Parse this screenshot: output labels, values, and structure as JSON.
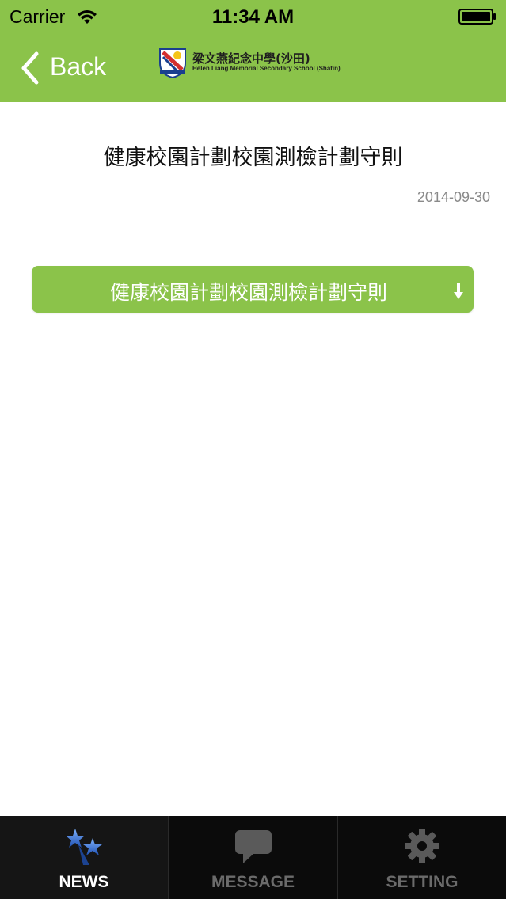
{
  "status_bar": {
    "carrier": "Carrier",
    "time": "11:34 AM"
  },
  "nav": {
    "back_label": "Back",
    "school_name_zh": "梁文燕紀念中學(沙田)",
    "school_name_en": "Helen Liang Memorial Secondary School (Shatin)"
  },
  "article": {
    "title": "健康校園計劃校園測檢計劃守則",
    "date": "2014-09-30",
    "attachment_label": "健康校園計劃校園測檢計劃守則"
  },
  "tabs": [
    {
      "label": "NEWS",
      "icon": "stars-icon",
      "selected": true
    },
    {
      "label": "MESSAGE",
      "icon": "speech-bubble-icon",
      "selected": false
    },
    {
      "label": "SETTING",
      "icon": "gear-icon",
      "selected": false
    }
  ],
  "colors": {
    "accent": "#8bc34a",
    "tab_bar": "#0b0b0b",
    "tab_active_label": "#ffffff",
    "tab_inactive_label": "#6b6b6b"
  }
}
